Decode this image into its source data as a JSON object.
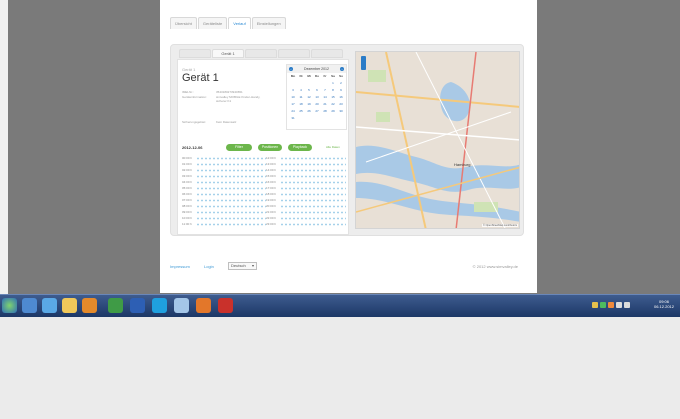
{
  "tabs": [
    "Übersicht",
    "Geräteliste",
    "Verlauf",
    "Einstellungen"
  ],
  "active_tab": 2,
  "device_tabs": [
    "Gerät 1"
  ],
  "device": {
    "label": "Gerät 1",
    "name": "Gerät 1",
    "info": [
      {
        "key": "IMEI-Nr.:",
        "value": "3543180273940651"
      },
      {
        "key": "Geräteinformation:",
        "value": "simvalley MOBILE Kinder-Handy, sicherer K1"
      },
      {
        "key": "Sicherungsgebiet:",
        "value": "Kein Datensatz"
      }
    ]
  },
  "calendar": {
    "title": "Dezember 2012",
    "prev": "‹",
    "next": "›",
    "weekdays": [
      "Mo",
      "Di",
      "Mi",
      "Do",
      "Fr",
      "Sa",
      "So"
    ],
    "days": [
      "",
      "",
      "",
      "",
      "",
      "1",
      "2",
      "3",
      "4",
      "5",
      "6",
      "7",
      "8",
      "9",
      "10",
      "11",
      "12",
      "13",
      "14",
      "15",
      "16",
      "17",
      "18",
      "19",
      "20",
      "21",
      "22",
      "23",
      "24",
      "25",
      "26",
      "27",
      "28",
      "29",
      "30",
      "31",
      "",
      "",
      "",
      "",
      "",
      ""
    ]
  },
  "controls": {
    "date": "2012-12-06",
    "buttons": [
      "Filter",
      "Positionen",
      "Playback"
    ],
    "alle_label": "Alle Daten"
  },
  "schedule": {
    "left_times": [
      "00:00 h",
      "01:00 h",
      "02:00 h",
      "03:00 h",
      "04:00 h",
      "05:00 h",
      "06:00 h",
      "07:00 h",
      "08:00 h",
      "09:00 h",
      "10:00 h",
      "11:00 h"
    ],
    "right_times": [
      "12:00 h",
      "13:00 h",
      "14:00 h",
      "15:00 h",
      "16:00 h",
      "17:00 h",
      "18:00 h",
      "19:00 h",
      "20:00 h",
      "21:00 h",
      "22:00 h",
      "23:00 h"
    ]
  },
  "map": {
    "city_label": "Hamburg",
    "attribution": "© OpenStreetMap contributors"
  },
  "footer": {
    "impressum": "Impressum",
    "login": "Login",
    "language": "Deutsch",
    "copyright": "© 2012 www.simvalley.de"
  },
  "taskbar": {
    "clock_time": "09:06",
    "clock_date": "06.12.2012"
  },
  "colors": {
    "accent": "#3f9ad6",
    "button_green": "#6cb64b",
    "taskbar": "#1c3766"
  }
}
